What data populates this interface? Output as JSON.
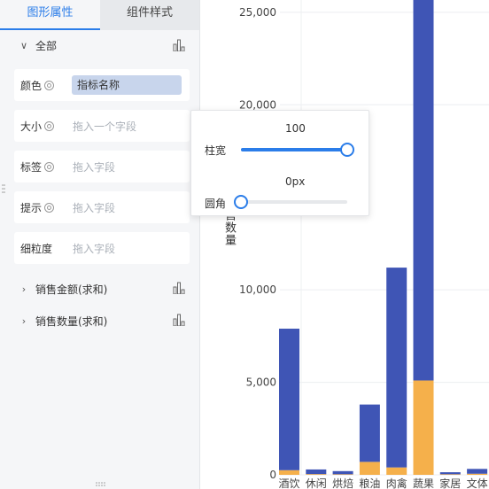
{
  "tabs": {
    "active": "图形属性",
    "inactive": "组件样式"
  },
  "sections": {
    "all": "全部",
    "sales_amount": "销售金额(求和)",
    "sales_qty": "销售数量(求和)"
  },
  "fields": [
    {
      "label": "颜色",
      "value": "指标名称",
      "filled": true
    },
    {
      "label": "大小",
      "value": "拖入一个字段",
      "filled": false
    },
    {
      "label": "标签",
      "value": "拖入字段",
      "filled": false
    },
    {
      "label": "提示",
      "value": "拖入字段",
      "filled": false
    },
    {
      "label": "细粒度",
      "value": "拖入字段",
      "filled": false
    }
  ],
  "popover": {
    "bar_width_label": "柱宽",
    "bar_width_value": "100",
    "bar_width_fraction": 1.0,
    "radius_label": "圆角",
    "radius_value": "0px",
    "radius_fraction": 0.0
  },
  "chart_data": {
    "type": "bar",
    "stacked": true,
    "ylabel": "售数量",
    "yticks": [
      "0",
      "5,000",
      "10,000",
      "20,000",
      "25,000"
    ],
    "ylim": [
      0,
      26000
    ],
    "categories": [
      "酒饮",
      "休闲",
      "烘焙",
      "粮油",
      "肉禽",
      "蔬果",
      "家居",
      "文体"
    ],
    "series": [
      {
        "color": "#f5b04b",
        "values": [
          250,
          40,
          30,
          700,
          400,
          5100,
          30,
          60
        ]
      },
      {
        "color": "#3f55b5",
        "values": [
          7650,
          250,
          170,
          3100,
          10800,
          21000,
          110,
          260
        ]
      }
    ],
    "colors": {
      "accent": "#2b7de9",
      "series_blue": "#3f55b5",
      "series_orange": "#f5b04b"
    }
  }
}
